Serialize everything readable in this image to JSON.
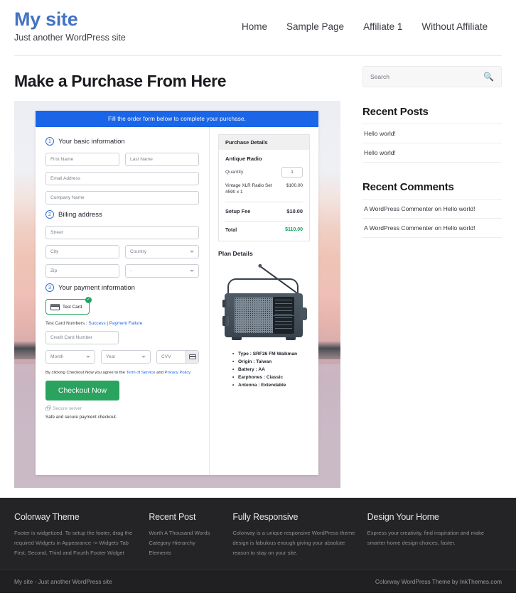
{
  "header": {
    "site_title": "My site",
    "tagline": "Just another WordPress site",
    "nav": [
      {
        "label": "Home"
      },
      {
        "label": "Sample Page"
      },
      {
        "label": "Affiliate 1"
      },
      {
        "label": "Without Affiliate"
      }
    ]
  },
  "main": {
    "page_title": "Make a Purchase From Here",
    "order_form": {
      "banner": "Fill the order form below to complete your purchase.",
      "steps": [
        {
          "num": "1",
          "label": "Your basic information"
        },
        {
          "num": "2",
          "label": "Billing address"
        },
        {
          "num": "3",
          "label": "Your payment information"
        }
      ],
      "fields": {
        "first_name": "First Name",
        "last_name": "Last Name",
        "email": "Email Address",
        "company": "Company Name",
        "street": "Street",
        "city": "City",
        "country": "Country",
        "zip": "Zip",
        "state": "-",
        "credit_card_number": "Credit Card Number",
        "month": "Month",
        "year": "Year",
        "cvv": "CVV"
      },
      "payment_method": {
        "label": "Test Card",
        "badge": "✓"
      },
      "test_card": {
        "prefix": "Test Card Numbers : ",
        "success": "Success",
        "separator": " | ",
        "failure": "Payment Failure"
      },
      "agreement": {
        "prefix": "By clicking Checkout Now you agree to the ",
        "tos": "Term of Service",
        "middle": " and ",
        "privacy": "Privacy Policy"
      },
      "checkout_button": "Checkout Now",
      "secure_server": "Secure server",
      "safe_note": "Safe and secure payment checkout."
    },
    "purchase_details": {
      "heading": "Purchase Details",
      "item_title": "Antique Radio",
      "quantity_label": "Quantity",
      "quantity_value": "1",
      "line_item_label": "Vintage XLR Radio Set 4590 x 1",
      "line_item_amount": "$100.00",
      "setup_fee_label": "Setup Fee",
      "setup_fee_amount": "$10.00",
      "total_label": "Total",
      "total_amount": "$110.00",
      "total_color": "#18a05a"
    },
    "plan_details": {
      "heading": "Plan Details",
      "specs": [
        "Type : SRF26 FM Walkman",
        "Origin : Taiwan",
        "Battery : AA",
        "Earphones : Classic",
        "Antenna : Extendable"
      ]
    }
  },
  "sidebar": {
    "search": {
      "placeholder": "Search",
      "icon": "search-icon",
      "glyph": "🔍"
    },
    "recent_posts": {
      "title": "Recent Posts",
      "items": [
        {
          "label": "Hello world!"
        },
        {
          "label": "Hello world!"
        }
      ]
    },
    "recent_comments": {
      "title": "Recent Comments",
      "items": [
        {
          "label": "A WordPress Commenter on Hello world!"
        },
        {
          "label": "A WordPress Commenter on Hello world!"
        }
      ]
    }
  },
  "footer": {
    "columns": [
      {
        "title": "Colorway Theme",
        "text": "Footer is widgetized. To setup the footer, drag the required Widgets in Appearance -> Widgets Tab First, Second, Third and Fourth Footer Widget"
      },
      {
        "title": "Recent Post",
        "items": [
          {
            "label": "Worth A Thousand Words"
          },
          {
            "label": "Category Hierarchy"
          },
          {
            "label": "Elements"
          }
        ]
      },
      {
        "title": "Fully Responsive",
        "text": "Colorway is a unique responsive WordPress theme design is fabulous enough giving your absolute reason to stay on your site."
      },
      {
        "title": "Design Your Home",
        "text": "Express your creativity, find inspiration and make smarter home design choices, faster."
      }
    ],
    "copyright_left": "My site - Just another WordPress site",
    "copyright_right": "Colorway WordPress Theme by InkThemes.com"
  },
  "colors": {
    "brand": "#4472c4",
    "banner_blue": "#1a65e8",
    "accent_green": "#2aa35f",
    "link_blue": "#1a65e8",
    "footer_bg": "#242426"
  }
}
